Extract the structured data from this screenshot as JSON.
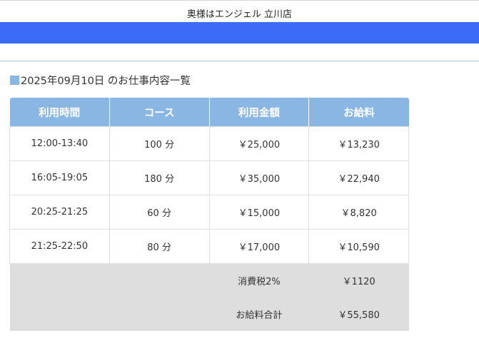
{
  "colors": {
    "accent_blue": "#3b6bf7",
    "header_blue": "#8ab6e4",
    "summary_gray": "#dedede"
  },
  "header": {
    "shop_name": "奥様はエンジェル 立川店"
  },
  "page": {
    "heading_icon": "blue-square-icon",
    "heading": "2025年09月10日 のお仕事内容一覧"
  },
  "table": {
    "columns": [
      "利用時間",
      "コース",
      "利用金額",
      "お給料"
    ],
    "rows": [
      [
        "12:00-13:40",
        "100 分",
        "￥25,000",
        "￥13,230"
      ],
      [
        "16:05-19:05",
        "180 分",
        "￥35,000",
        "￥22,940"
      ],
      [
        "20:25-21:25",
        "60 分",
        "￥15,000",
        "￥8,820"
      ],
      [
        "21:25-22:50",
        "80 分",
        "￥17,000",
        "￥10,590"
      ]
    ],
    "summary": [
      {
        "label": "消費税2%",
        "value": "￥1120"
      },
      {
        "label": "お給料合計",
        "value": "￥55,580"
      }
    ]
  }
}
